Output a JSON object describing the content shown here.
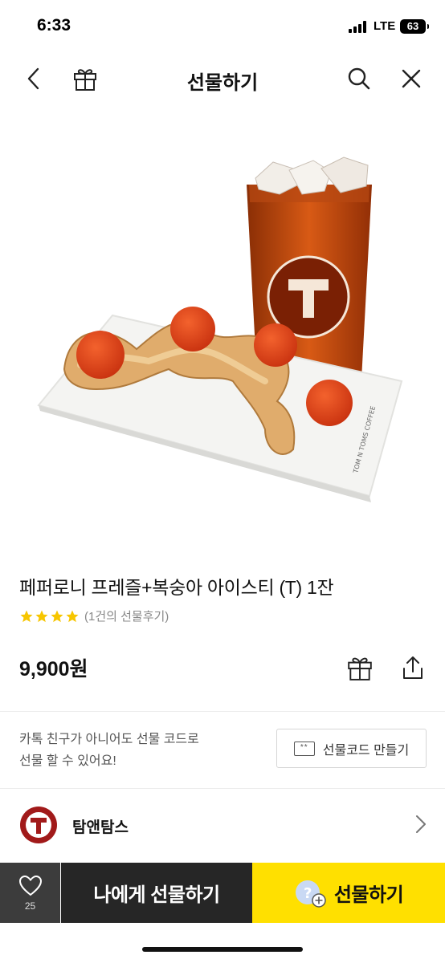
{
  "status_bar": {
    "time": "6:33",
    "network": "LTE",
    "battery": "63"
  },
  "nav": {
    "title": "선물하기",
    "back_icon": "back-chevron-icon",
    "gift_icon": "gift-box-icon",
    "search_icon": "search-icon",
    "close_icon": "close-icon"
  },
  "product": {
    "title": "페퍼로니 프레즐+복숭아 아이스티 (T) 1잔",
    "stars": 4,
    "review_text": "(1건의 선물후기)",
    "price": "9,900원",
    "cup_logo_text": "TOM N TOMS COFFEE",
    "plate_text": "TOM N TOMS COFFEE",
    "colors": {
      "star": "#f7c600",
      "tea": "#c84a12"
    }
  },
  "gift_code": {
    "info_line1": "카톡 친구가 아니어도 선물 코드로",
    "info_line2": "선물 할 수 있어요!",
    "button_label": "선물코드 만들기",
    "icon_text": "**"
  },
  "brand": {
    "name": "탐앤탐스",
    "logo_text": "TOM N TOMS COFFEE"
  },
  "bottom_bar": {
    "wish_count": "25",
    "self_gift_label": "나에게 선물하기",
    "gift_label": "선물하기",
    "colors": {
      "dark": "#262626",
      "accent": "#ffe000"
    }
  }
}
